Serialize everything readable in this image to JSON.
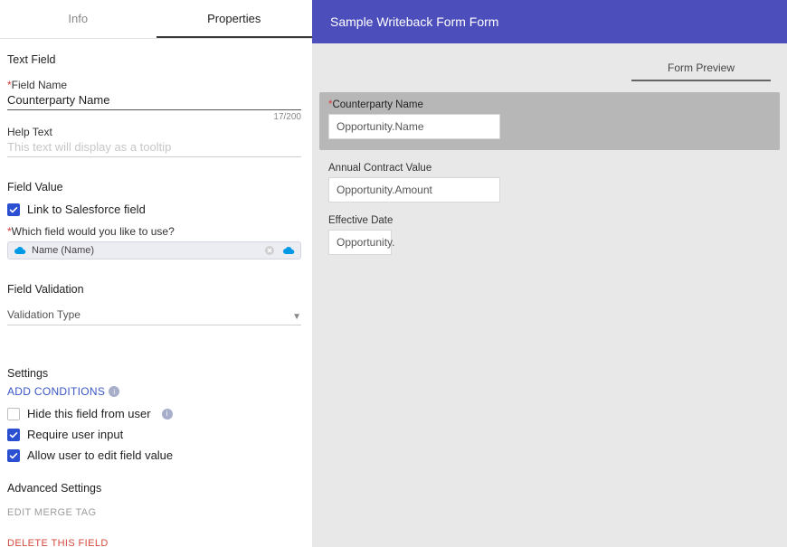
{
  "tabs": {
    "info": "Info",
    "properties": "Properties"
  },
  "sections": {
    "textField": "Text Field",
    "fieldName": "Field Name",
    "fieldNameValue": "Counterparty Name",
    "fieldNameCounter": "17/200",
    "helpText": "Help Text",
    "helpPlaceholder": "This text will display as a tooltip",
    "fieldValue": "Field Value",
    "linkToSalesforce": "Link to Salesforce field",
    "whichField": "Which field would you like to use?",
    "sfFieldName": "Name (Name)",
    "fieldValidation": "Field Validation",
    "validationType": "Validation Type",
    "settings": "Settings",
    "addConditions": "ADD CONDITIONS",
    "hideField": "Hide this field from user",
    "requireInput": "Require user input",
    "allowEdit": "Allow user to edit field value",
    "advanced": "Advanced Settings",
    "editMerge": "EDIT MERGE TAG",
    "deleteField": "DELETE THIS FIELD"
  },
  "right": {
    "title": "Sample Writeback Form Form",
    "previewTab": "Form Preview",
    "fields": {
      "f1_label": "Counterparty Name",
      "f1_value": "Opportunity.Name",
      "f2_label": "Annual Contract Value",
      "f2_value": "Opportunity.Amount",
      "f3_label": "Effective Date",
      "f3_value": "Opportunity."
    }
  }
}
